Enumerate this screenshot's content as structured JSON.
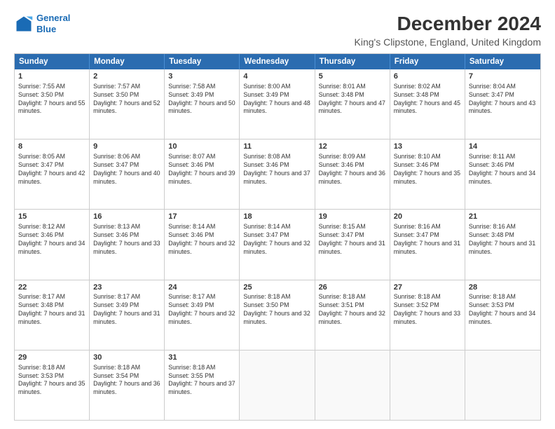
{
  "header": {
    "logo_line1": "General",
    "logo_line2": "Blue",
    "main_title": "December 2024",
    "subtitle": "King's Clipstone, England, United Kingdom"
  },
  "calendar": {
    "days": [
      "Sunday",
      "Monday",
      "Tuesday",
      "Wednesday",
      "Thursday",
      "Friday",
      "Saturday"
    ],
    "rows": [
      [
        {
          "day": "1",
          "sunrise": "Sunrise: 7:55 AM",
          "sunset": "Sunset: 3:50 PM",
          "daylight": "Daylight: 7 hours and 55 minutes."
        },
        {
          "day": "2",
          "sunrise": "Sunrise: 7:57 AM",
          "sunset": "Sunset: 3:50 PM",
          "daylight": "Daylight: 7 hours and 52 minutes."
        },
        {
          "day": "3",
          "sunrise": "Sunrise: 7:58 AM",
          "sunset": "Sunset: 3:49 PM",
          "daylight": "Daylight: 7 hours and 50 minutes."
        },
        {
          "day": "4",
          "sunrise": "Sunrise: 8:00 AM",
          "sunset": "Sunset: 3:49 PM",
          "daylight": "Daylight: 7 hours and 48 minutes."
        },
        {
          "day": "5",
          "sunrise": "Sunrise: 8:01 AM",
          "sunset": "Sunset: 3:48 PM",
          "daylight": "Daylight: 7 hours and 47 minutes."
        },
        {
          "day": "6",
          "sunrise": "Sunrise: 8:02 AM",
          "sunset": "Sunset: 3:48 PM",
          "daylight": "Daylight: 7 hours and 45 minutes."
        },
        {
          "day": "7",
          "sunrise": "Sunrise: 8:04 AM",
          "sunset": "Sunset: 3:47 PM",
          "daylight": "Daylight: 7 hours and 43 minutes."
        }
      ],
      [
        {
          "day": "8",
          "sunrise": "Sunrise: 8:05 AM",
          "sunset": "Sunset: 3:47 PM",
          "daylight": "Daylight: 7 hours and 42 minutes."
        },
        {
          "day": "9",
          "sunrise": "Sunrise: 8:06 AM",
          "sunset": "Sunset: 3:47 PM",
          "daylight": "Daylight: 7 hours and 40 minutes."
        },
        {
          "day": "10",
          "sunrise": "Sunrise: 8:07 AM",
          "sunset": "Sunset: 3:46 PM",
          "daylight": "Daylight: 7 hours and 39 minutes."
        },
        {
          "day": "11",
          "sunrise": "Sunrise: 8:08 AM",
          "sunset": "Sunset: 3:46 PM",
          "daylight": "Daylight: 7 hours and 37 minutes."
        },
        {
          "day": "12",
          "sunrise": "Sunrise: 8:09 AM",
          "sunset": "Sunset: 3:46 PM",
          "daylight": "Daylight: 7 hours and 36 minutes."
        },
        {
          "day": "13",
          "sunrise": "Sunrise: 8:10 AM",
          "sunset": "Sunset: 3:46 PM",
          "daylight": "Daylight: 7 hours and 35 minutes."
        },
        {
          "day": "14",
          "sunrise": "Sunrise: 8:11 AM",
          "sunset": "Sunset: 3:46 PM",
          "daylight": "Daylight: 7 hours and 34 minutes."
        }
      ],
      [
        {
          "day": "15",
          "sunrise": "Sunrise: 8:12 AM",
          "sunset": "Sunset: 3:46 PM",
          "daylight": "Daylight: 7 hours and 34 minutes."
        },
        {
          "day": "16",
          "sunrise": "Sunrise: 8:13 AM",
          "sunset": "Sunset: 3:46 PM",
          "daylight": "Daylight: 7 hours and 33 minutes."
        },
        {
          "day": "17",
          "sunrise": "Sunrise: 8:14 AM",
          "sunset": "Sunset: 3:46 PM",
          "daylight": "Daylight: 7 hours and 32 minutes."
        },
        {
          "day": "18",
          "sunrise": "Sunrise: 8:14 AM",
          "sunset": "Sunset: 3:47 PM",
          "daylight": "Daylight: 7 hours and 32 minutes."
        },
        {
          "day": "19",
          "sunrise": "Sunrise: 8:15 AM",
          "sunset": "Sunset: 3:47 PM",
          "daylight": "Daylight: 7 hours and 31 minutes."
        },
        {
          "day": "20",
          "sunrise": "Sunrise: 8:16 AM",
          "sunset": "Sunset: 3:47 PM",
          "daylight": "Daylight: 7 hours and 31 minutes."
        },
        {
          "day": "21",
          "sunrise": "Sunrise: 8:16 AM",
          "sunset": "Sunset: 3:48 PM",
          "daylight": "Daylight: 7 hours and 31 minutes."
        }
      ],
      [
        {
          "day": "22",
          "sunrise": "Sunrise: 8:17 AM",
          "sunset": "Sunset: 3:48 PM",
          "daylight": "Daylight: 7 hours and 31 minutes."
        },
        {
          "day": "23",
          "sunrise": "Sunrise: 8:17 AM",
          "sunset": "Sunset: 3:49 PM",
          "daylight": "Daylight: 7 hours and 31 minutes."
        },
        {
          "day": "24",
          "sunrise": "Sunrise: 8:17 AM",
          "sunset": "Sunset: 3:49 PM",
          "daylight": "Daylight: 7 hours and 32 minutes."
        },
        {
          "day": "25",
          "sunrise": "Sunrise: 8:18 AM",
          "sunset": "Sunset: 3:50 PM",
          "daylight": "Daylight: 7 hours and 32 minutes."
        },
        {
          "day": "26",
          "sunrise": "Sunrise: 8:18 AM",
          "sunset": "Sunset: 3:51 PM",
          "daylight": "Daylight: 7 hours and 32 minutes."
        },
        {
          "day": "27",
          "sunrise": "Sunrise: 8:18 AM",
          "sunset": "Sunset: 3:52 PM",
          "daylight": "Daylight: 7 hours and 33 minutes."
        },
        {
          "day": "28",
          "sunrise": "Sunrise: 8:18 AM",
          "sunset": "Sunset: 3:53 PM",
          "daylight": "Daylight: 7 hours and 34 minutes."
        }
      ],
      [
        {
          "day": "29",
          "sunrise": "Sunrise: 8:18 AM",
          "sunset": "Sunset: 3:53 PM",
          "daylight": "Daylight: 7 hours and 35 minutes."
        },
        {
          "day": "30",
          "sunrise": "Sunrise: 8:18 AM",
          "sunset": "Sunset: 3:54 PM",
          "daylight": "Daylight: 7 hours and 36 minutes."
        },
        {
          "day": "31",
          "sunrise": "Sunrise: 8:18 AM",
          "sunset": "Sunset: 3:55 PM",
          "daylight": "Daylight: 7 hours and 37 minutes."
        },
        null,
        null,
        null,
        null
      ]
    ]
  }
}
